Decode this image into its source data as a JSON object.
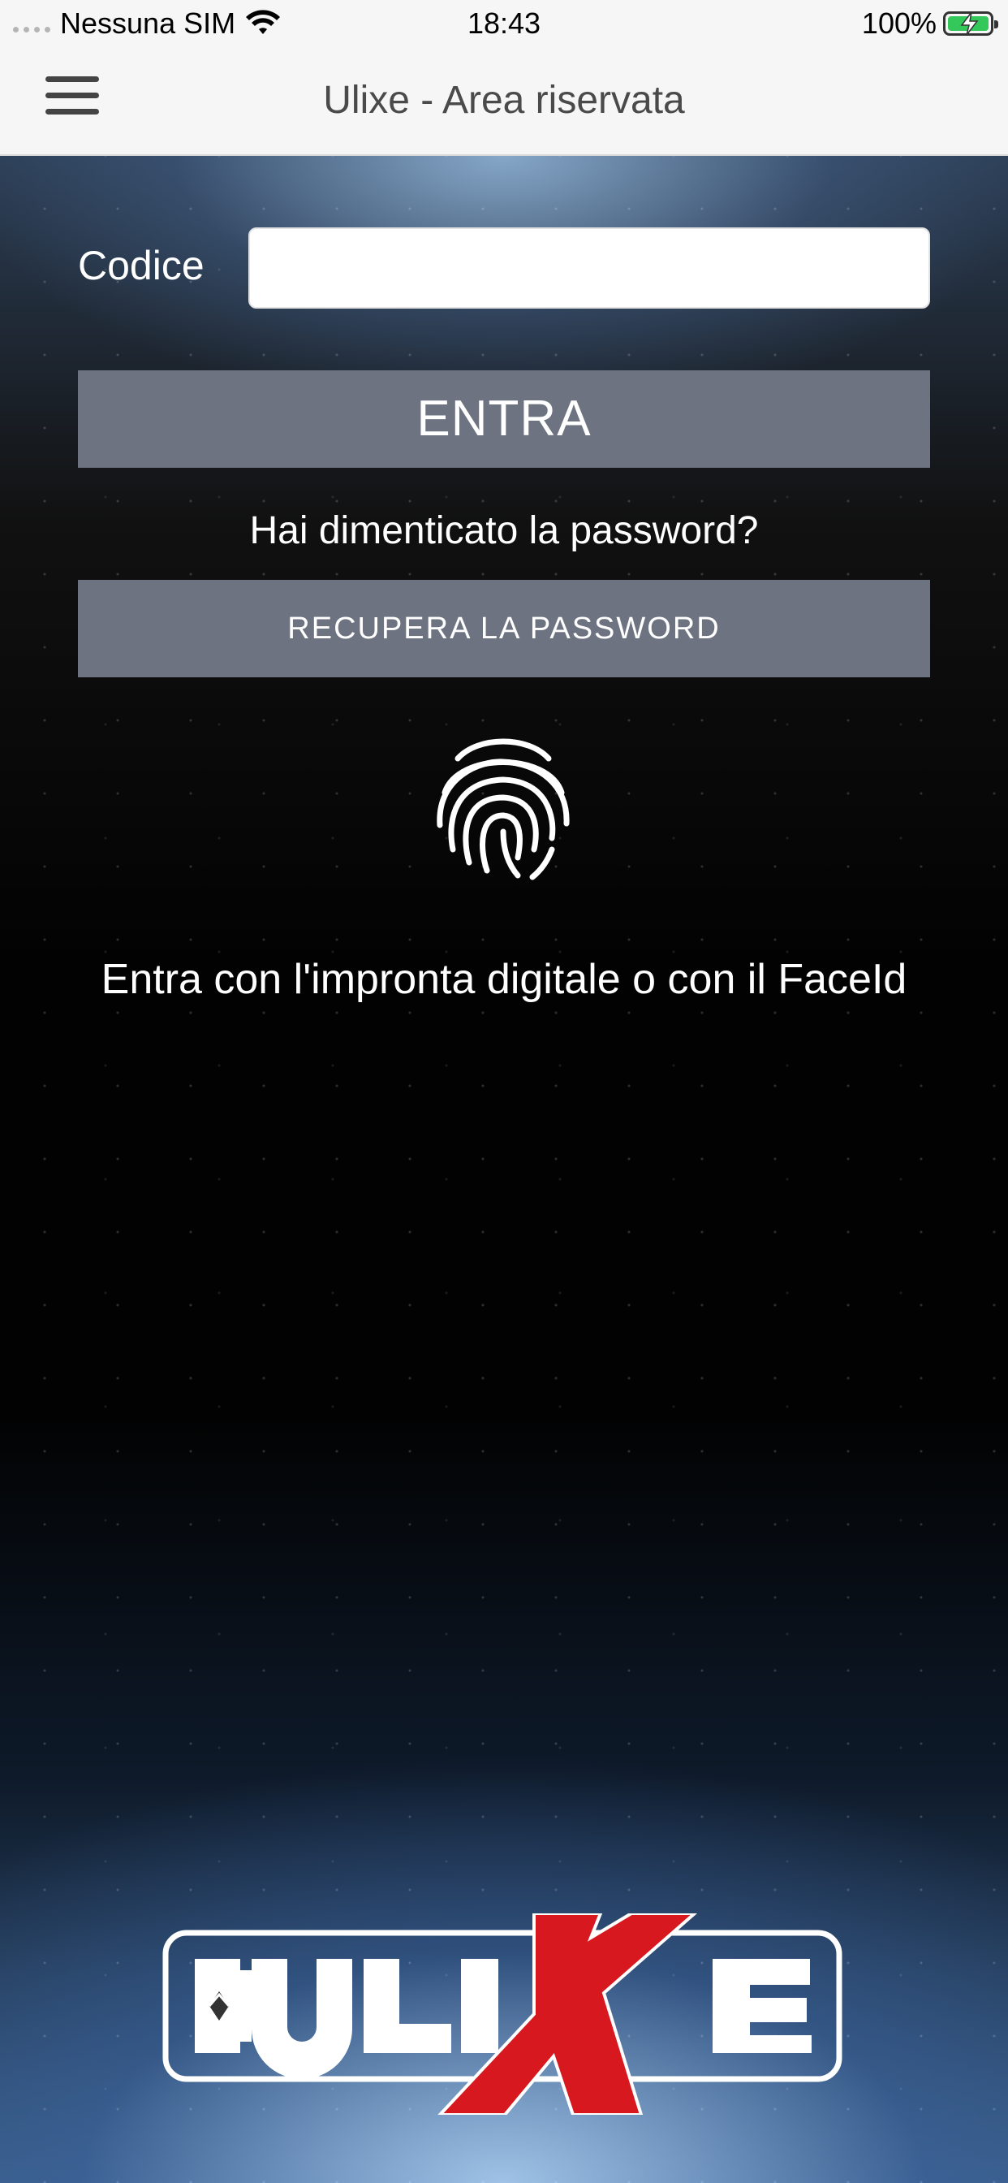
{
  "status_bar": {
    "carrier": "Nessuna SIM",
    "time": "18:43",
    "battery_percent": "100%",
    "battery_level": 1.0,
    "wifi_icon": "wifi-icon",
    "battery_icon": "battery-charging-icon"
  },
  "nav": {
    "title": "Ulixe - Area riservata",
    "menu_icon": "hamburger-menu-icon"
  },
  "login": {
    "code_label": "Codice",
    "code_value": "",
    "code_placeholder": "",
    "enter_label": "ENTRA",
    "forgot_text": "Hai dimenticato la password?",
    "recover_label": "RECUPERA LA PASSWORD",
    "fingerprint_icon": "fingerprint-icon",
    "biometric_text": "Entra con l'impronta digitale o con il FaceId"
  },
  "logo": {
    "text": "ULIXE"
  },
  "colors": {
    "button_bg": "#6d7381",
    "nav_bg": "#f6f6f6",
    "logo_red": "#d7191f",
    "battery_green": "#34c759"
  }
}
